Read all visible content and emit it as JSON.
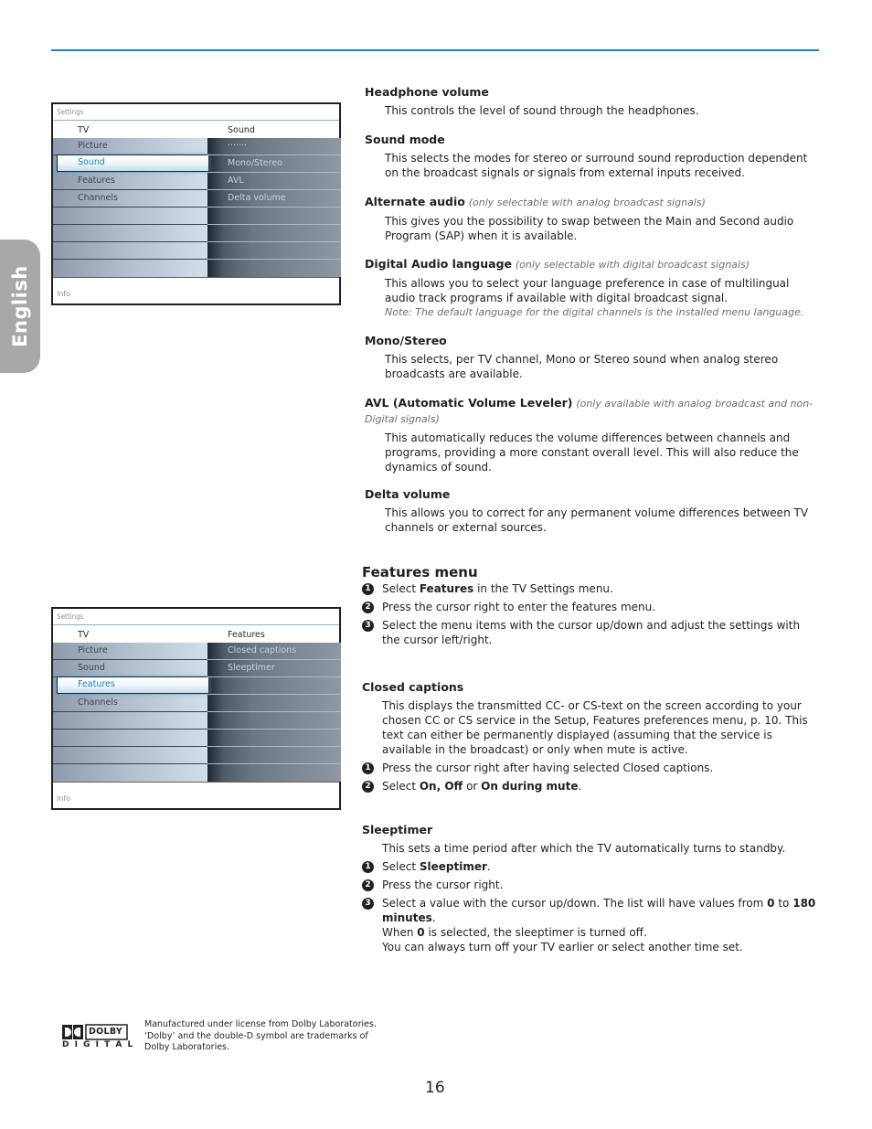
{
  "side_tab": {
    "label": "English"
  },
  "menu_sound": {
    "settings_label": "Settings",
    "header_left": "TV",
    "header_right": "Sound",
    "left_items": [
      "Picture",
      "Sound",
      "Features",
      "Channels"
    ],
    "selected_item": "Sound",
    "right_items": [
      "·······",
      "Mono/Stereo",
      "AVL",
      "Delta volume"
    ],
    "info_label": "Info"
  },
  "menu_features": {
    "settings_label": "Settings",
    "header_left": "TV",
    "header_right": "Features",
    "left_items": [
      "Picture",
      "Sound",
      "Features",
      "Channels"
    ],
    "selected_item": "Features",
    "right_items": [
      "Closed captions",
      "Sleeptimer"
    ],
    "info_label": "Info"
  },
  "sound_sections": {
    "headphone": {
      "title": "Headphone volume",
      "body": "This controls the level of sound through the headphones."
    },
    "sound_mode": {
      "title": "Sound mode",
      "body": "This selects the modes for stereo or surround sound reproduction dependent on the broadcast signals or signals from external inputs received."
    },
    "alternate_audio": {
      "title": "Alternate audio",
      "qualifier": "(only selectable with analog broadcast signals)",
      "body": "This gives you the possibility to swap between the Main and Second audio Program (SAP) when it is available."
    },
    "digital_audio": {
      "title": "Digital Audio language",
      "qualifier": "(only selectable with digital broadcast signals)",
      "body": "This allows you to select your language preference in case of multilingual audio track programs if available with digital broadcast signal.",
      "note": "Note: The default language for the digital channels is the installed menu language."
    },
    "mono_stereo": {
      "title": "Mono/Stereo",
      "body": "This selects, per TV channel, Mono or Stereo sound when analog stereo broadcasts are available."
    },
    "avl": {
      "title": "AVL (Automatic Volume Leveler)",
      "qualifier": "(only available with analog broadcast and non-Digital signals)",
      "body": "This automatically reduces the volume differences between channels and programs, providing a more constant overall level. This will also reduce the dynamics of sound."
    },
    "delta_volume": {
      "title": "Delta volume",
      "body": "This allows you to correct for any permanent volume differences between TV channels or external sources."
    }
  },
  "features_menu": {
    "title": "Features menu",
    "steps": [
      {
        "n": "1",
        "pre": "Select ",
        "bold": "Features",
        "post": " in the TV Settings menu."
      },
      {
        "n": "2",
        "text": "Press the cursor right to enter the features menu."
      },
      {
        "n": "3",
        "text": "Select the menu items with the cursor up/down and adjust the settings with the cursor left/right."
      }
    ]
  },
  "closed_captions": {
    "title": "Closed captions",
    "body": "This displays the transmitted CC- or CS-text on the screen according to your chosen CC or CS service in the Setup, Features preferences menu, p. 10. This text can either be permanently displayed (assuming that the service is available in the broadcast) or only when mute is active.",
    "steps": [
      {
        "n": "1",
        "text": "Press the cursor right after having selected Closed captions."
      },
      {
        "n": "2",
        "pre": "Select ",
        "b1": "On, Off",
        "mid": " or ",
        "b2": "On during mute",
        "post": "."
      }
    ]
  },
  "sleeptimer": {
    "title": "Sleeptimer",
    "body": "This sets a time period after which the TV automatically turns to standby.",
    "steps": [
      {
        "n": "1",
        "pre": "Select ",
        "bold": "Sleeptimer",
        "post": "."
      },
      {
        "n": "2",
        "text": "Press the cursor right."
      },
      {
        "n": "3",
        "pre": "Select a value with the cursor up/down. The list will have values from ",
        "b1": "0",
        "mid": " to ",
        "b2": "180 minutes",
        "post": "."
      }
    ],
    "extra1_pre": "When ",
    "extra1_bold": "0",
    "extra1_post": " is selected, the sleeptimer is turned off.",
    "extra2": "You can always turn off your TV earlier or select another time set."
  },
  "footer": {
    "dolby_logo_text": "DOLBY",
    "dolby_digital_text": "D I G I T A L",
    "license_text": "Manufactured under license from Dolby Laboratories. ‘Dolby’ and the double-D symbol are trademarks of Dolby Laboratories.",
    "page_number": "16"
  }
}
